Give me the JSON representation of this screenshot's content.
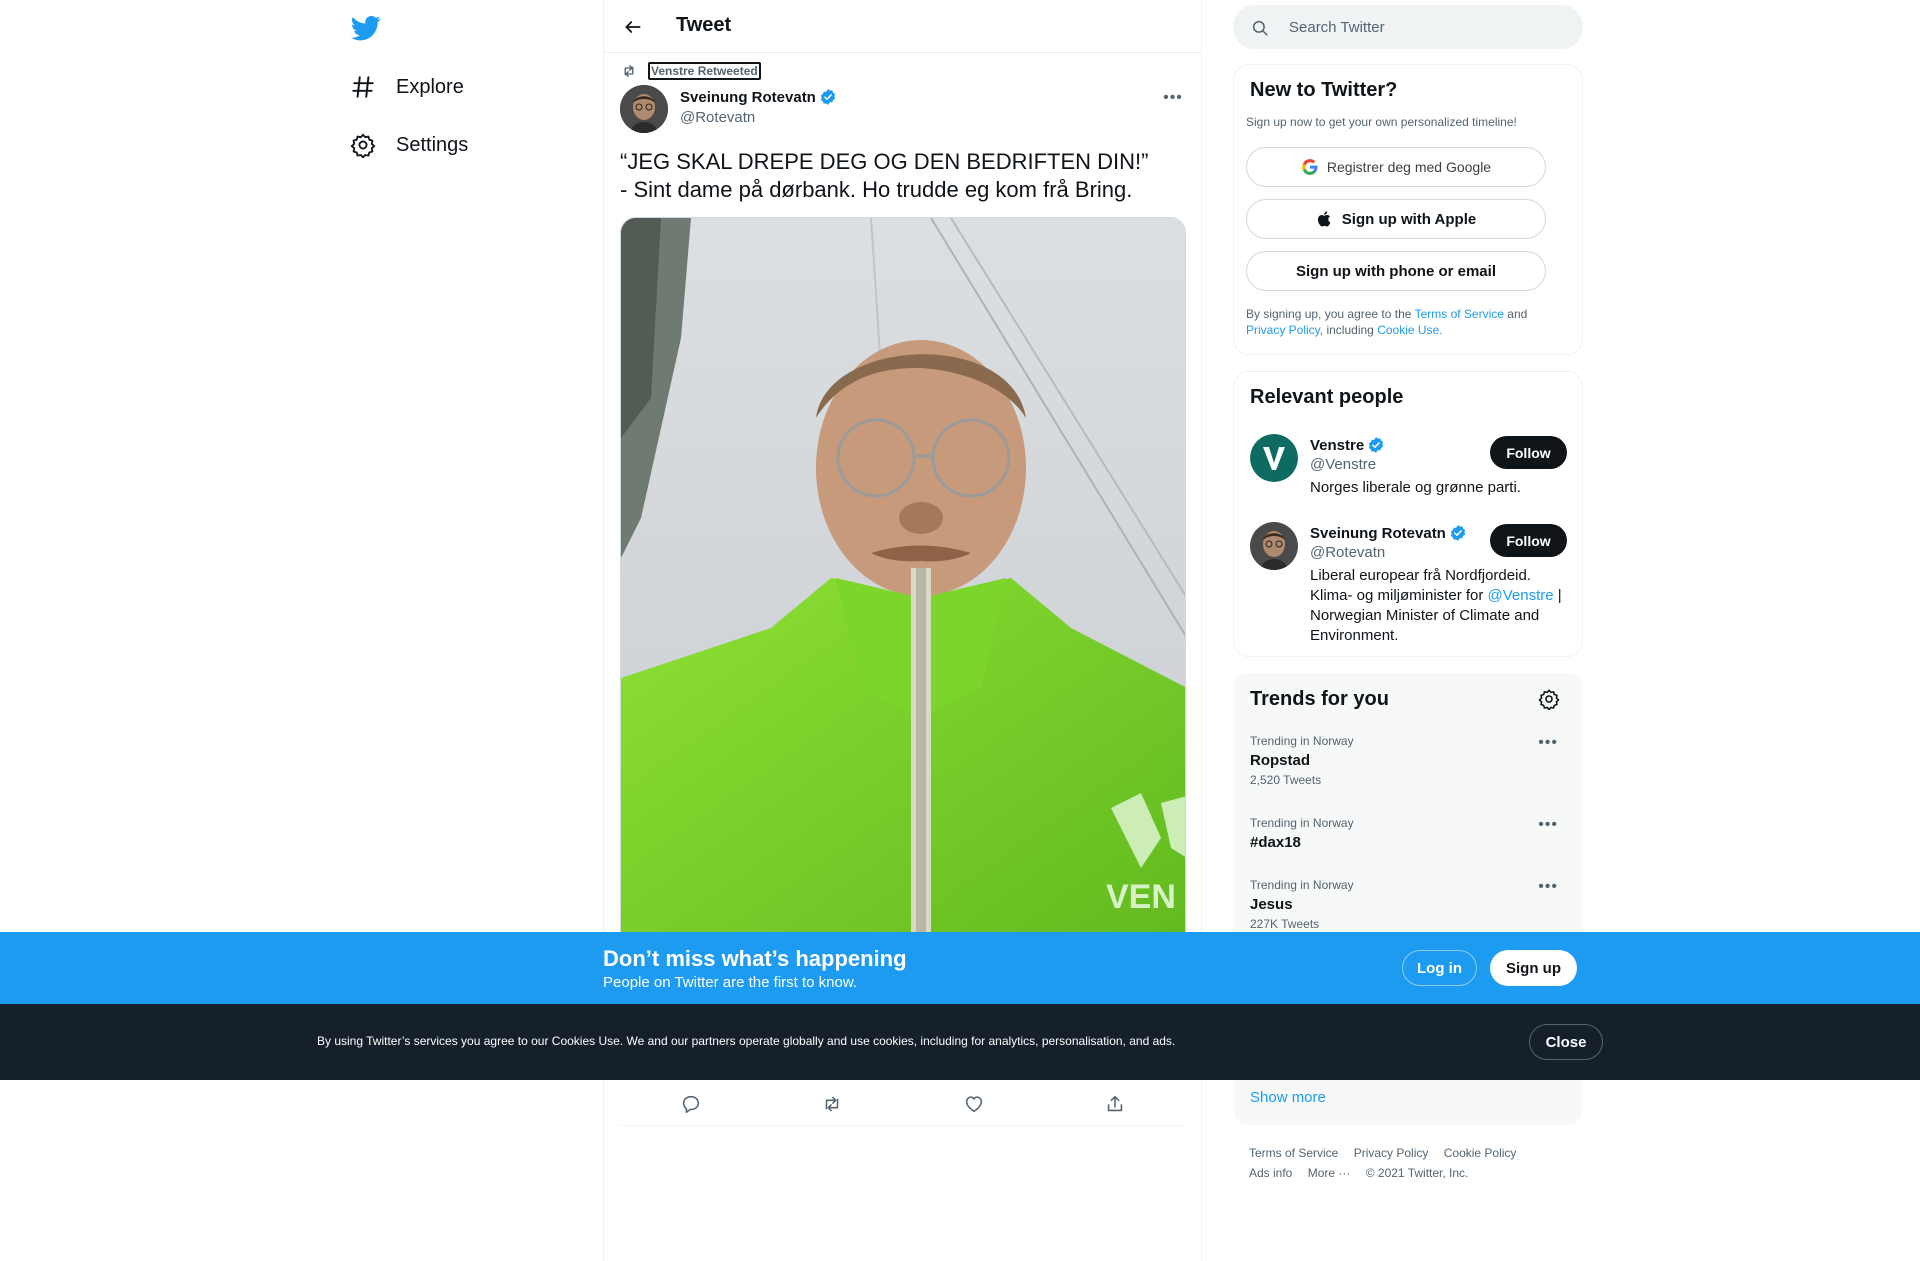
{
  "nav": {
    "explore": "Explore",
    "settings": "Settings"
  },
  "header": {
    "title": "Tweet"
  },
  "tweet": {
    "retweeted_by": "Venstre Retweeted",
    "author_name": "Sveinung Rotevatn",
    "author_handle": "@Rotevatn",
    "text": "“JEG SKAL DREPE DEG OG DEN BEDRIFTEN DIN!”\n- Sint dame på dørbank. Ho trudde eg kom frå Bring."
  },
  "search": {
    "placeholder": "Search Twitter"
  },
  "signup": {
    "title": "New to Twitter?",
    "subtitle": "Sign up now to get your own personalized timeline!",
    "google": "Registrer deg med Google",
    "apple": "Sign up with Apple",
    "phone": "Sign up with phone or email",
    "legal_prefix": "By signing up, you agree to the",
    "terms": "Terms of Service",
    "and": "and",
    "privacy": "Privacy Policy",
    "including": ", including",
    "cookie": "Cookie Use."
  },
  "people": {
    "title": "Relevant people",
    "items": [
      {
        "name": "Venstre",
        "handle": "@Venstre",
        "follow": "Follow",
        "bio": "Norges liberale og grønne parti."
      },
      {
        "name": "Sveinung Rotevatn",
        "handle": "@Rotevatn",
        "follow": "Follow",
        "bio_1": "Liberal europear frå Nordfjordeid. Klima- og miljøminister for",
        "bio_link": "@Venstre",
        "bio_2": "| Norwegian Minister of Climate and Environment."
      }
    ]
  },
  "trends": {
    "title": "Trends for you",
    "items": [
      {
        "context": "Trending in Norway",
        "name": "Ropstad",
        "count": "2,520 Tweets"
      },
      {
        "context": "Trending in Norway",
        "name": "#dax18",
        "count": ""
      },
      {
        "context": "Trending in Norway",
        "name": "Jesus",
        "count": "227K Tweets"
      }
    ],
    "show_more": "Show more"
  },
  "footer": {
    "terms": "Terms of Service",
    "privacy": "Privacy Policy",
    "cookie": "Cookie Policy",
    "ads": "Ads info",
    "more": "More ···",
    "copyright": "© 2021 Twitter, Inc."
  },
  "banner": {
    "title": "Don’t miss what’s happening",
    "subtitle": "People on Twitter are the first to know.",
    "login": "Log in",
    "signup": "Sign up"
  },
  "cookie": {
    "text": "By using Twitter’s services you agree to our Cookies Use. We and our partners operate globally and use cookies, including for analytics, personalisation, and ads.",
    "close": "Close"
  },
  "colors": {
    "brand": "#1d9bf0",
    "text": "#0f1419",
    "secondary": "#536471",
    "cookie_bg": "#15202b"
  }
}
